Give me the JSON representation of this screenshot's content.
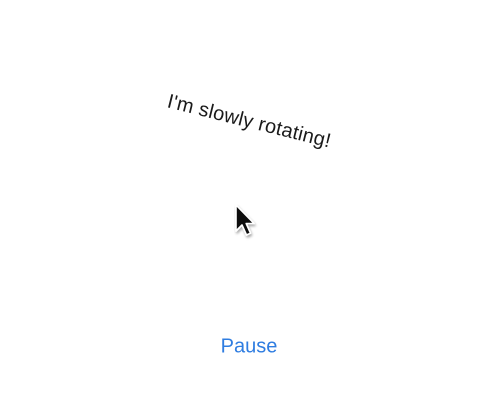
{
  "animation": {
    "text": "I'm slowly rotating!"
  },
  "controls": {
    "pause_label": "Pause"
  },
  "cursor": {
    "icon": "arrow-pointer"
  },
  "colors": {
    "accent": "#2f7de1",
    "text": "#1a1a1a",
    "background": "#ffffff"
  }
}
